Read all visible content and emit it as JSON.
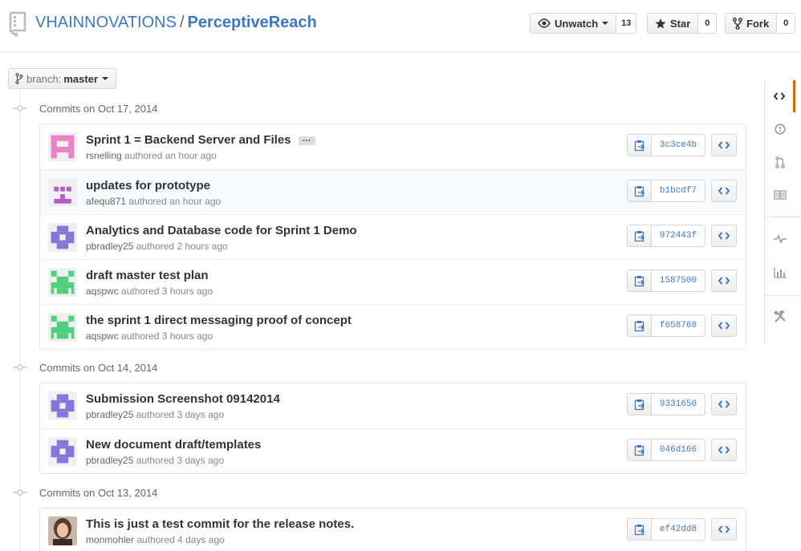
{
  "header": {
    "owner": "VHAINNOVATIONS",
    "separator": "/",
    "repo": "PerceptiveReach",
    "watch": {
      "label": "Unwatch",
      "count": "13"
    },
    "star": {
      "label": "Star",
      "count": "0"
    },
    "fork": {
      "label": "Fork",
      "count": "0"
    }
  },
  "branch": {
    "label": "branch:",
    "value": "master"
  },
  "groups": [
    {
      "title": "Commits on Oct 17, 2014",
      "commits": [
        {
          "message": "Sprint 1 = Backend Server and Files",
          "ellipsis": "…",
          "author": "rsnelling",
          "time": "authored an hour ago",
          "sha": "3c3ce4b",
          "avatar_color": "#e983c6"
        },
        {
          "message": "updates for prototype",
          "author": "afequ871",
          "time": "authored an hour ago",
          "sha": "b1bcdf7",
          "avatar_color": "#b65bc7"
        },
        {
          "message": "Analytics and Database code for Sprint 1 Demo",
          "author": "pbradley25",
          "time": "authored 2 hours ago",
          "sha": "972443f",
          "avatar_color": "#8477d9"
        },
        {
          "message": "draft master test plan",
          "author": "aqspwc",
          "time": "authored 3 hours ago",
          "sha": "1587500",
          "avatar_color": "#4ed07f"
        },
        {
          "message": "the sprint 1 direct messaging proof of concept",
          "author": "aqspwc",
          "time": "authored 3 hours ago",
          "sha": "f658768",
          "avatar_color": "#4ed07f"
        }
      ]
    },
    {
      "title": "Commits on Oct 14, 2014",
      "commits": [
        {
          "message": "Submission Screenshot 09142014",
          "author": "pbradley25",
          "time": "authored 3 days ago",
          "sha": "9331650",
          "avatar_color": "#8477d9"
        },
        {
          "message": "New document draft/templates",
          "author": "pbradley25",
          "time": "authored 3 days ago",
          "sha": "046d166",
          "avatar_color": "#8477d9"
        }
      ]
    },
    {
      "title": "Commits on Oct 13, 2014",
      "commits": [
        {
          "message": "This is just a test commit for the release notes.",
          "author": "monmohler",
          "time": "authored 4 days ago",
          "sha": "ef42dd8",
          "avatar_color": "#6b4a3a"
        }
      ]
    }
  ],
  "side_nav": [
    "code-icon",
    "issues-icon",
    "pull-request-icon",
    "wiki-icon",
    "pulse-icon",
    "graphs-icon",
    "settings-icon"
  ],
  "colors": {
    "link": "#4078c0",
    "accent": "#d26911"
  }
}
